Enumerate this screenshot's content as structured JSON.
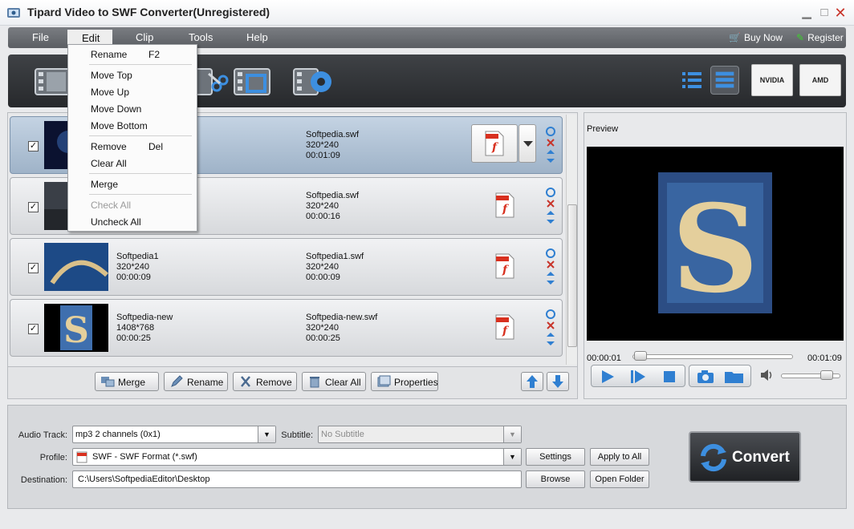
{
  "window": {
    "title": "Tipard Video to SWF Converter(Unregistered)"
  },
  "menubar": {
    "items": [
      "File",
      "Edit",
      "Clip",
      "Tools",
      "Help"
    ],
    "buy_now": "Buy Now",
    "register": "Register"
  },
  "edit_menu": {
    "rename": "Rename",
    "rename_key": "F2",
    "move_top": "Move Top",
    "move_up": "Move Up",
    "move_down": "Move Down",
    "move_bottom": "Move Bottom",
    "remove": "Remove",
    "remove_key": "Del",
    "clear_all": "Clear All",
    "merge": "Merge",
    "check_all": "Check All",
    "uncheck_all": "Uncheck All"
  },
  "gpu": {
    "nvidia": "NVIDIA",
    "amd": "AMD"
  },
  "files": [
    {
      "name": "",
      "res": "",
      "dur": "",
      "out_name": "Softpedia.swf",
      "out_res": "320*240",
      "out_dur": "00:01:09",
      "checked": true
    },
    {
      "name": "",
      "res": "",
      "dur": "",
      "out_name": "Softpedia.swf",
      "out_res": "320*240",
      "out_dur": "00:00:16",
      "checked": true
    },
    {
      "name": "Softpedia1",
      "res": "320*240",
      "dur": "00:00:09",
      "out_name": "Softpedia1.swf",
      "out_res": "320*240",
      "out_dur": "00:00:09",
      "checked": true
    },
    {
      "name": "Softpedia-new",
      "res": "1408*768",
      "dur": "00:00:25",
      "out_name": "Softpedia-new.swf",
      "out_res": "320*240",
      "out_dur": "00:00:25",
      "checked": true
    }
  ],
  "list_buttons": {
    "merge": "Merge",
    "rename": "Rename",
    "remove": "Remove",
    "clear_all": "Clear All",
    "properties": "Properties"
  },
  "preview": {
    "label": "Preview",
    "time_current": "00:00:01",
    "time_total": "00:01:09",
    "progress_fraction": 0.01,
    "volume_fraction": 0.85
  },
  "settings": {
    "audio_track_label": "Audio Track:",
    "audio_track_value": "mp3 2 channels (0x1)",
    "subtitle_label": "Subtitle:",
    "subtitle_value": "No Subtitle",
    "profile_label": "Profile:",
    "profile_value": "SWF - SWF Format (*.swf)",
    "destination_label": "Destination:",
    "destination_value": "C:\\Users\\SoftpediaEditor\\Desktop",
    "settings_btn": "Settings",
    "apply_all_btn": "Apply to All",
    "browse_btn": "Browse",
    "open_folder_btn": "Open Folder",
    "convert_btn": "Convert"
  },
  "colors": {
    "accent": "#2f7fd1",
    "swf_red": "#d8301f",
    "close_red": "#c8342a",
    "green": "#3ecf2e"
  }
}
